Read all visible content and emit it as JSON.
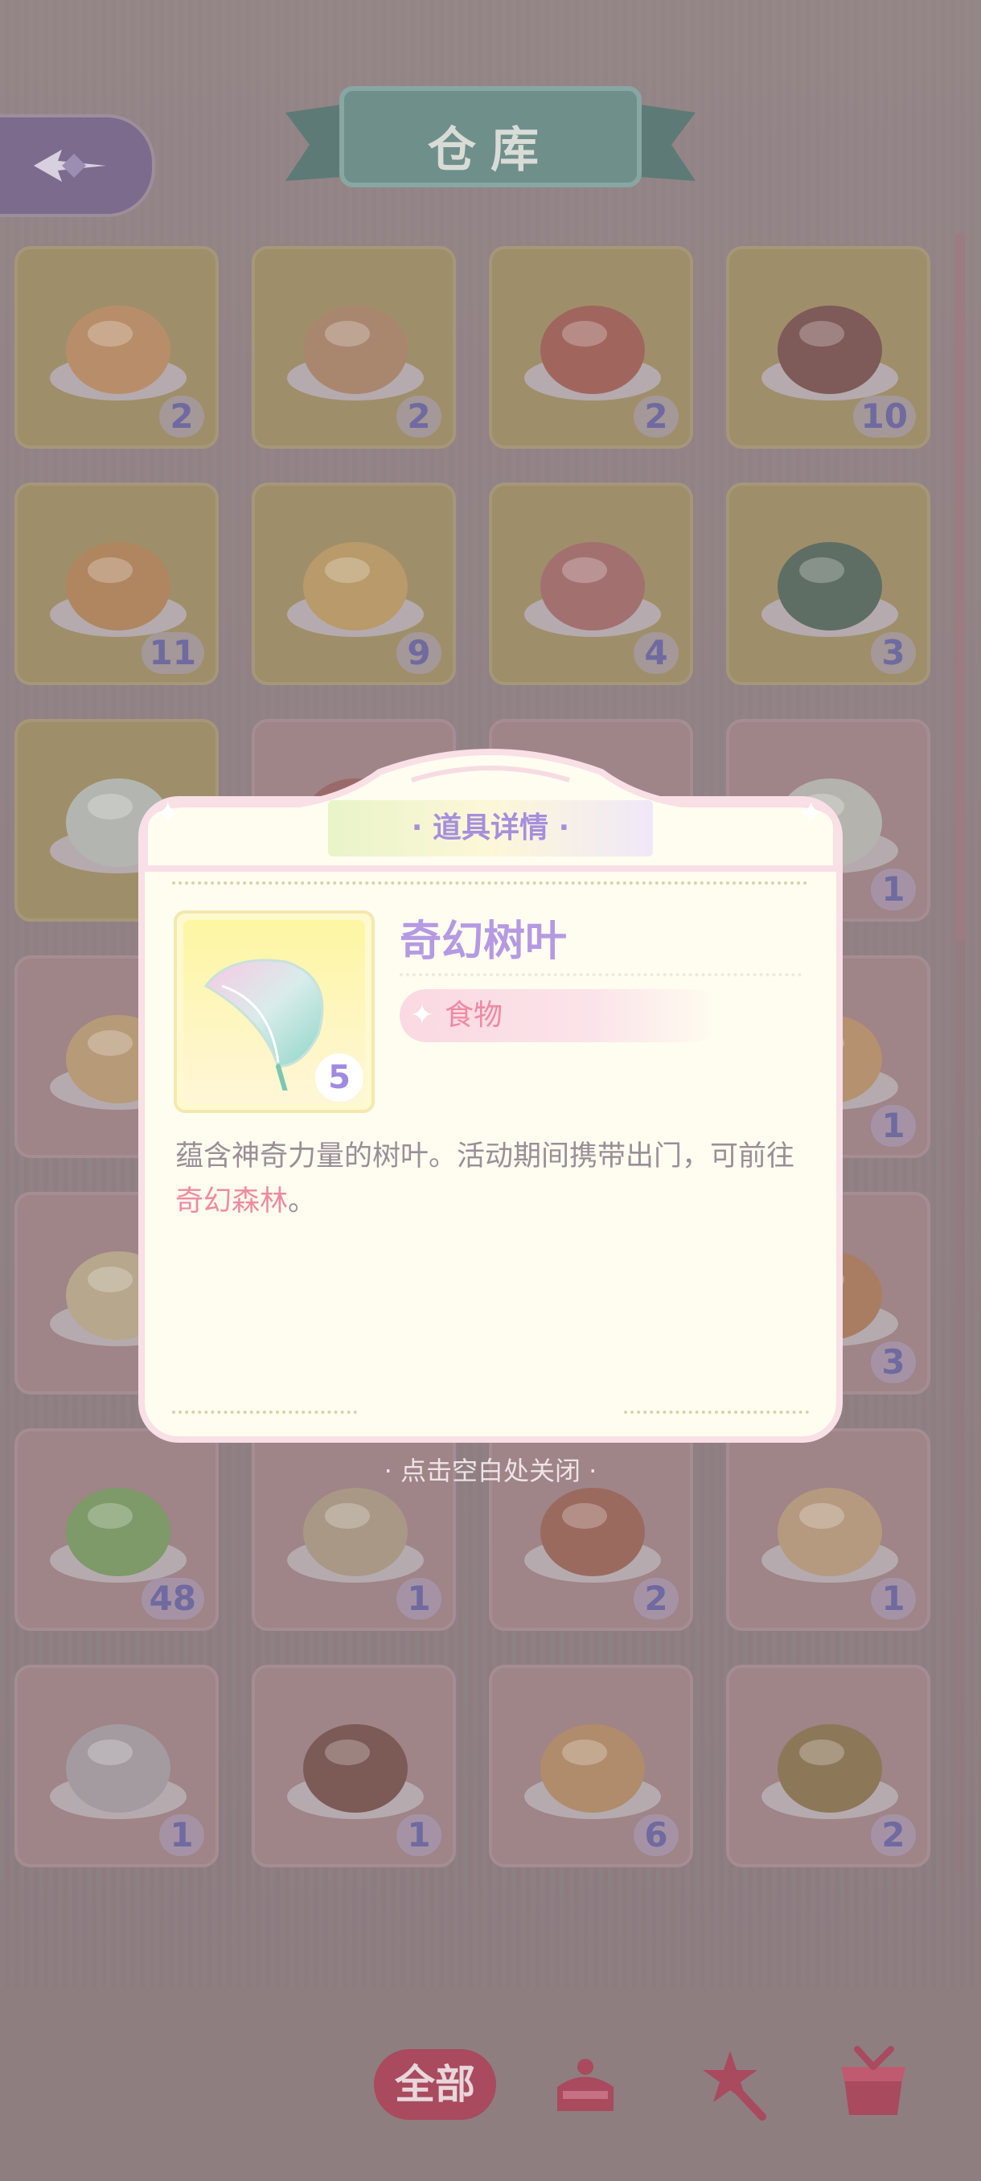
{
  "header": {
    "title": "仓库"
  },
  "items": [
    {
      "name": "crab-pastry",
      "count": "2",
      "bg": "yellow"
    },
    {
      "name": "golden-hotpot",
      "count": "2",
      "bg": "yellow"
    },
    {
      "name": "tomato-soup",
      "count": "2",
      "bg": "yellow"
    },
    {
      "name": "chocolate-pudding",
      "count": "10",
      "bg": "yellow"
    },
    {
      "name": "orange-pudding",
      "count": "11",
      "bg": "yellow"
    },
    {
      "name": "orange-juice",
      "count": "9",
      "bg": "yellow"
    },
    {
      "name": "crayfish-dish",
      "count": "4",
      "bg": "yellow"
    },
    {
      "name": "green-soup",
      "count": "3",
      "bg": "yellow"
    },
    {
      "name": "fantasy-leaf",
      "count": "",
      "bg": "yellow"
    },
    {
      "name": "sauce-bottle",
      "count": "",
      "bg": "pink"
    },
    {
      "name": "hidden-1",
      "count": "",
      "bg": "pink"
    },
    {
      "name": "jar",
      "count": "1",
      "bg": "pink"
    },
    {
      "name": "strawberry-pudding",
      "count": "",
      "bg": "pink"
    },
    {
      "name": "hidden-2",
      "count": "",
      "bg": "pink"
    },
    {
      "name": "hidden-3",
      "count": "",
      "bg": "pink"
    },
    {
      "name": "bread",
      "count": "1",
      "bg": "pink"
    },
    {
      "name": "egg-custard",
      "count": "",
      "bg": "pink"
    },
    {
      "name": "hidden-4",
      "count": "",
      "bg": "pink"
    },
    {
      "name": "hidden-5",
      "count": "",
      "bg": "pink"
    },
    {
      "name": "pizza-slice",
      "count": "3",
      "bg": "pink"
    },
    {
      "name": "green-wrap",
      "count": "48",
      "bg": "pink"
    },
    {
      "name": "toast-plate",
      "count": "1",
      "bg": "pink"
    },
    {
      "name": "baked-gratin",
      "count": "2",
      "bg": "pink"
    },
    {
      "name": "egg-crepe",
      "count": "1",
      "bg": "pink"
    },
    {
      "name": "dessert-bag",
      "count": "1",
      "bg": "pink"
    },
    {
      "name": "skewers",
      "count": "1",
      "bg": "pink"
    },
    {
      "name": "sandwich",
      "count": "6",
      "bg": "pink"
    },
    {
      "name": "fish-roll",
      "count": "2",
      "bg": "pink"
    }
  ],
  "modal": {
    "title": "· 道具详情 ·",
    "item_name": "奇幻树叶",
    "quantity": "5",
    "type": "食物",
    "desc_part1": "蕴含神奇力量的树叶。活动期间携带出门，可前往",
    "desc_highlight": "奇幻森林",
    "desc_part2": "。"
  },
  "close_hint": "· 点击空白处关闭 ·",
  "tabs": {
    "all": "全部"
  },
  "colors": {
    "accent_purple": "#b59ae3",
    "accent_pink": "#f08aa2",
    "tab_active": "#a94a5f"
  }
}
